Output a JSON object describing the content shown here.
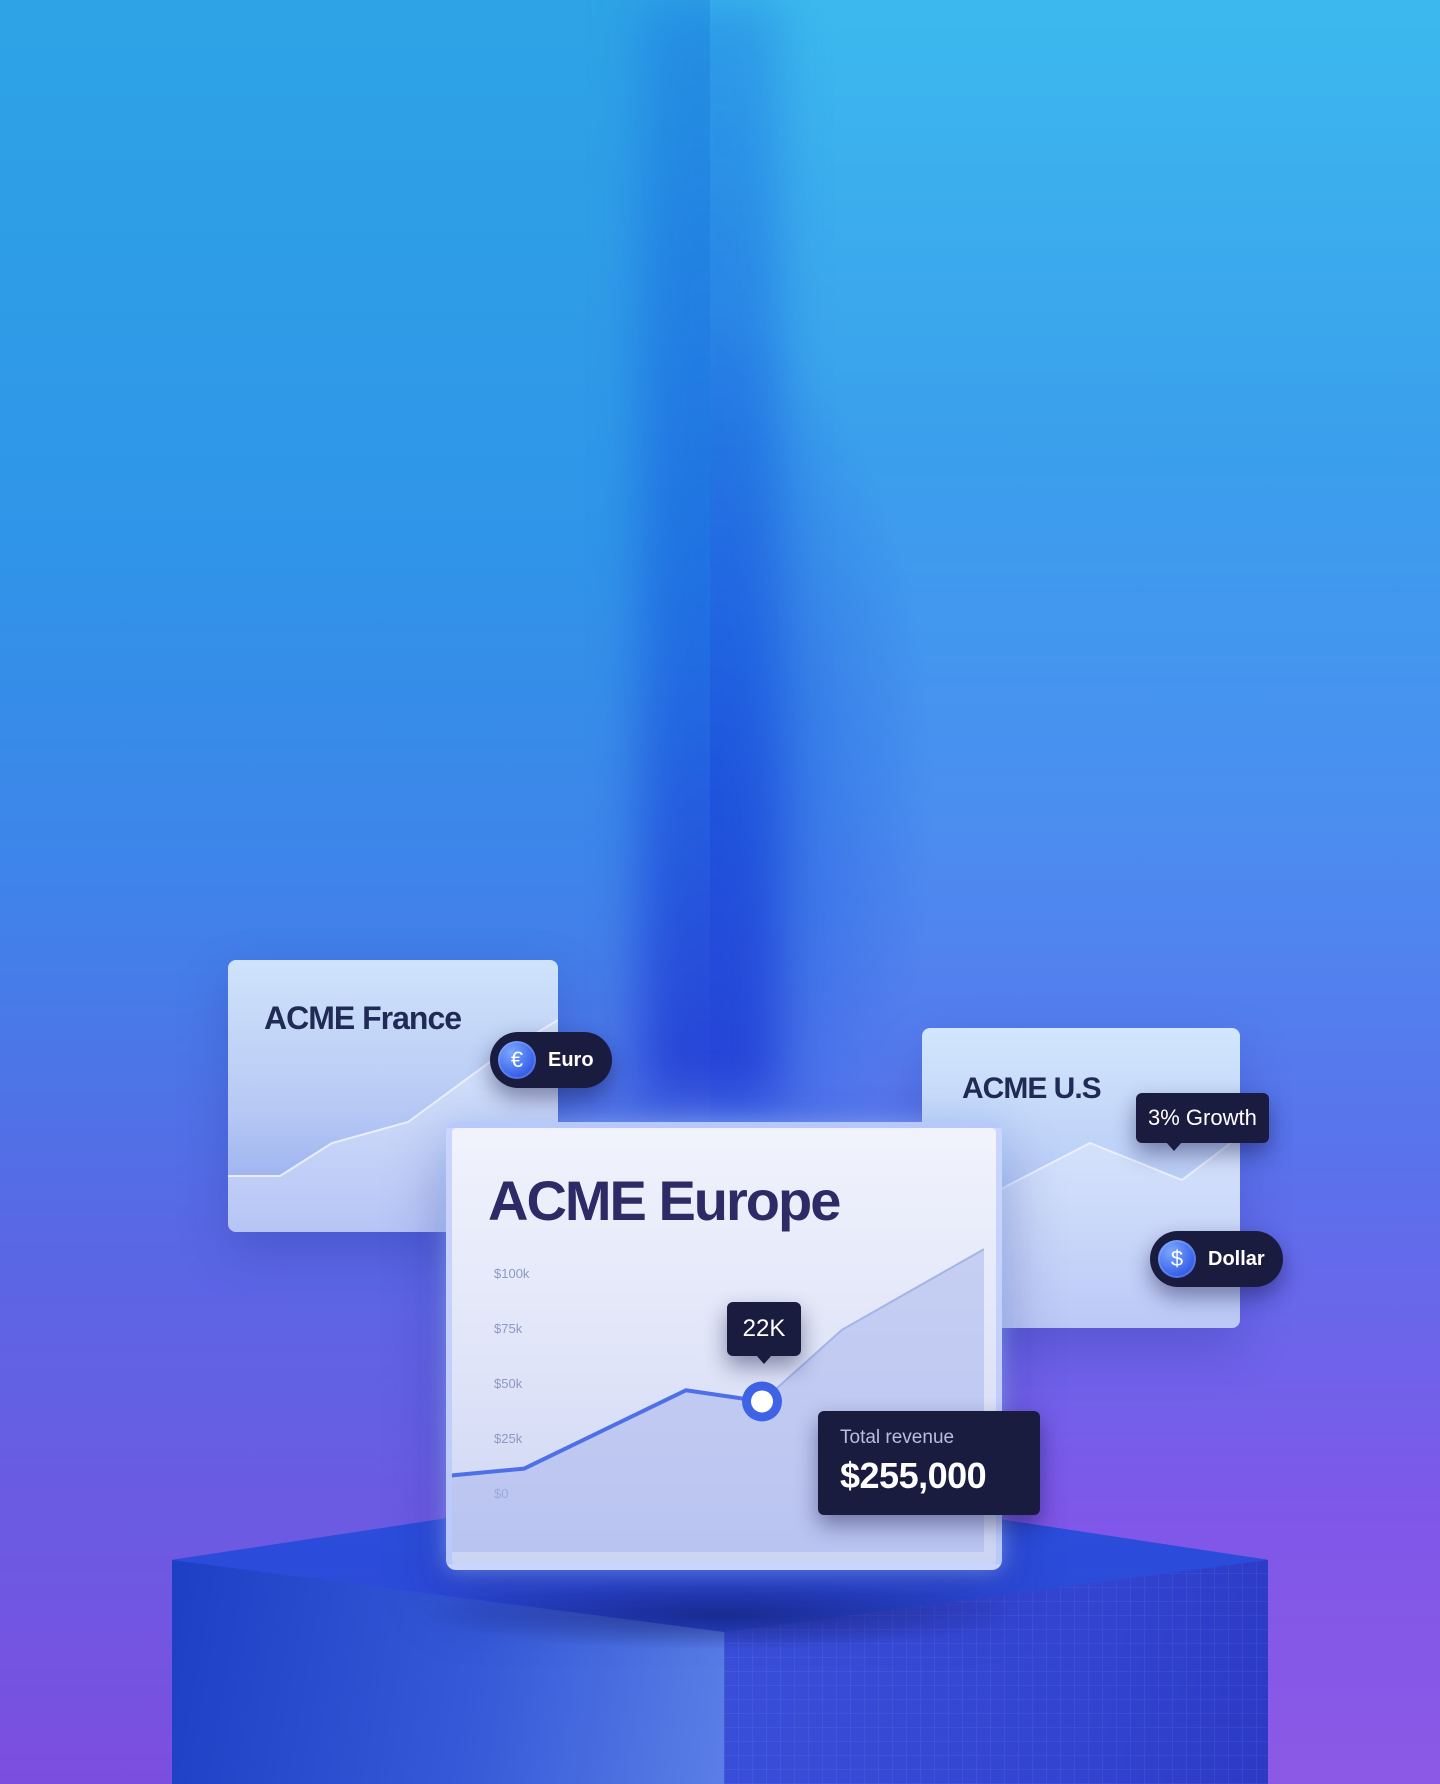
{
  "colors": {
    "accent": "#4f6fe8",
    "dark_tag": "#1a1c3f",
    "title_dark": "#2e2a66"
  },
  "cards": {
    "france": {
      "title": "ACME France",
      "currency_label": "Euro",
      "currency_symbol": "€",
      "currency_icon": "euro-coin-icon"
    },
    "us": {
      "title": "ACME U.S",
      "growth_label": "3% Growth",
      "currency_label": "Dollar",
      "currency_symbol": "$",
      "currency_icon": "dollar-coin-icon"
    },
    "europe": {
      "title": "ACME Europe",
      "point_label": "22K",
      "total_revenue_label": "Total revenue",
      "total_revenue_value": "$255,000"
    }
  },
  "chart_data": {
    "type": "line",
    "title": "ACME Europe",
    "y_ticks": [
      "$100k",
      "$75k",
      "$50k",
      "$25k",
      "$0"
    ],
    "ylim": [
      0,
      100000
    ],
    "x": [
      0,
      1,
      2,
      3,
      4,
      5
    ],
    "values": [
      11000,
      14000,
      49000,
      44000,
      76000,
      112000
    ],
    "highlight": {
      "index": 3,
      "label": "22K"
    },
    "grid": false
  }
}
